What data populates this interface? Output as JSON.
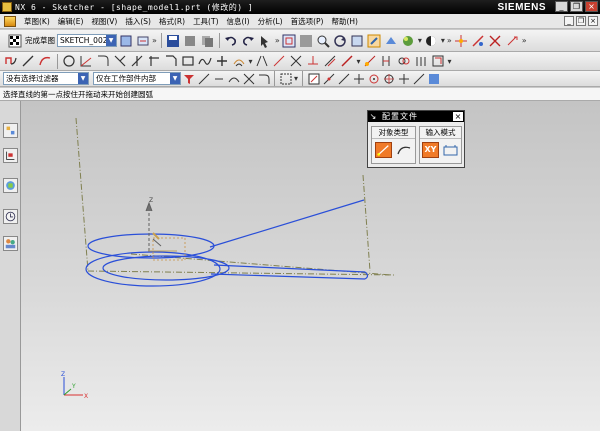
{
  "app": {
    "title": "NX 6 - Sketcher - [shape_model1.prt (修改的) ]",
    "brand": "SIEMENS"
  },
  "window_controls": {
    "minimize": "_",
    "restore": "❐",
    "close": "×"
  },
  "menu": {
    "items": [
      "草图(K)",
      "编辑(E)",
      "视图(V)",
      "插入(S)",
      "格式(R)",
      "工具(T)",
      "信息(I)",
      "分析(L)",
      "首选项(P)",
      "帮助(H)"
    ]
  },
  "toolbar1": {
    "finish_label": "完成草图",
    "sketch_name": "SKETCH_002"
  },
  "toolbar3": {
    "filter_value": "没有选择过滤器",
    "scope_value": "仅在工作部件内部"
  },
  "status": {
    "prompt": "选择直线的第一点按住开拖动来开始创建圆弧"
  },
  "profile_panel": {
    "title": "配置文件",
    "object_type_label": "对象类型",
    "input_mode_label": "输入模式",
    "input_mode_xy": "XY"
  },
  "viewport": {
    "triad_labels": {
      "z": "Z",
      "y": "Y",
      "x": "X"
    }
  },
  "colors": {
    "curve": "#2a4fd8",
    "datum": "#808050",
    "active_tool": "#f07a28",
    "titlebar": "#000000"
  }
}
